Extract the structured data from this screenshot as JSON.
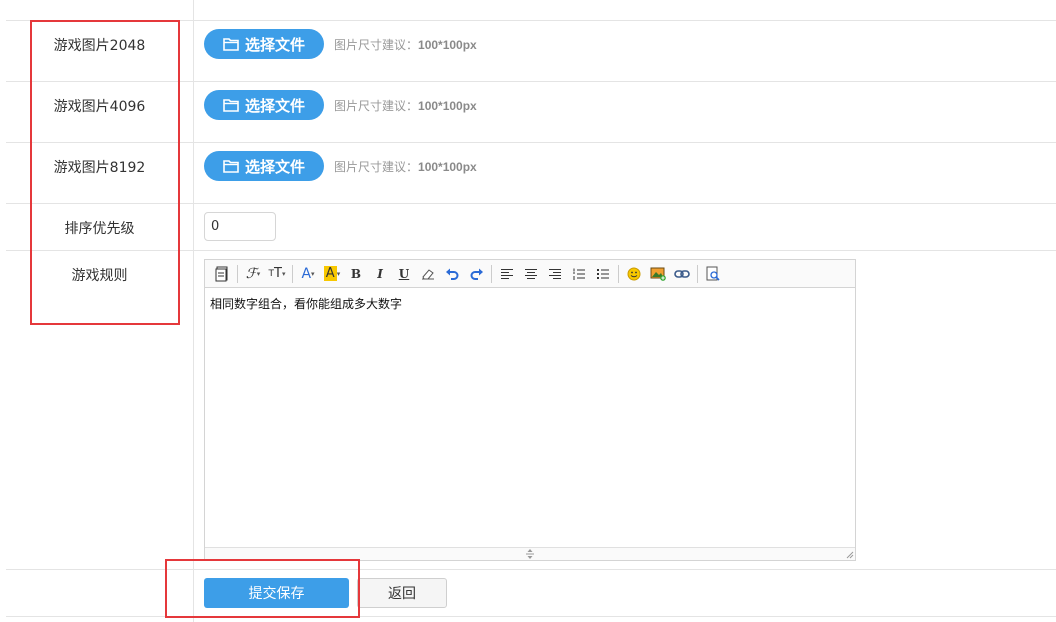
{
  "rows": [
    {
      "label": "游戏图片2048",
      "button": "选择文件",
      "hint_prefix": "图片尺寸建议：",
      "hint_size": "100*100px"
    },
    {
      "label": "游戏图片4096",
      "button": "选择文件",
      "hint_prefix": "图片尺寸建议：",
      "hint_size": "100*100px"
    },
    {
      "label": "游戏图片8192",
      "button": "选择文件",
      "hint_prefix": "图片尺寸建议：",
      "hint_size": "100*100px"
    }
  ],
  "sort": {
    "label": "排序优先级",
    "value": "0"
  },
  "rules": {
    "label": "游戏规则",
    "content": "相同数字组合，看你能组成多大数字"
  },
  "toolbar_icons": [
    "source-icon",
    "font-family-icon",
    "font-size-icon",
    "font-color-icon",
    "highlight-icon",
    "bold-icon",
    "italic-icon",
    "underline-icon",
    "eraser-icon",
    "undo-icon",
    "redo-icon",
    "align-left-icon",
    "align-center-icon",
    "align-right-icon",
    "ordered-list-icon",
    "unordered-list-icon",
    "emoji-icon",
    "image-icon",
    "link-icon",
    "preview-icon"
  ],
  "actions": {
    "save": "提交保存",
    "back": "返回"
  },
  "colors": {
    "primary": "#3d9ee8",
    "highlight_box": "#e5383b"
  }
}
